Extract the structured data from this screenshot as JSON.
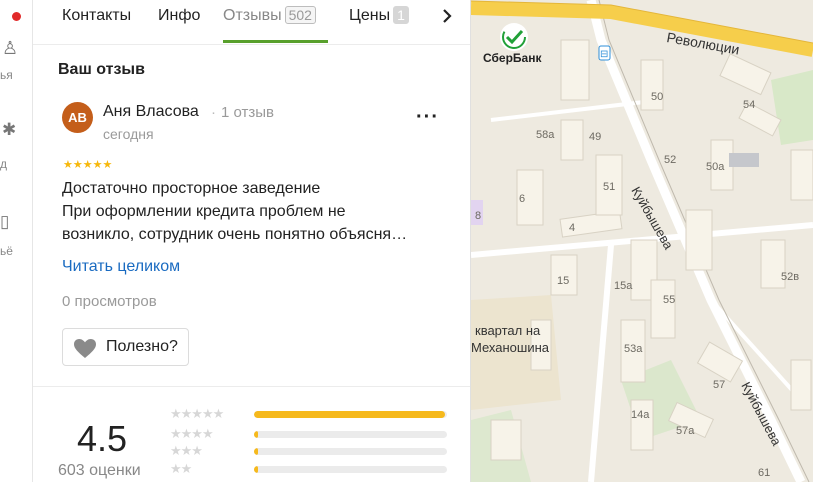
{
  "left_strip": {
    "fragments": [
      "ья",
      "д",
      "ьё"
    ]
  },
  "tabs": [
    {
      "label": "Контакты"
    },
    {
      "label": "Инфо"
    },
    {
      "label": "Отзывы",
      "count": "502"
    },
    {
      "label": "Цены",
      "count": "1"
    }
  ],
  "section": {
    "title": "Ваш отзыв"
  },
  "review": {
    "avatar_initials": "АВ",
    "author": "Аня Власова",
    "author_reviews": "1 отзыв",
    "date": "сегодня",
    "stars": 5,
    "stars_text": "★★★★★",
    "text_lines": [
      "Достаточно просторное заведение",
      "При оформлении кредита проблем не",
      "возникло, сотрудник очень понятно объясня…"
    ],
    "read_more": "Читать целиком",
    "views": "0 просмотров",
    "helpful_label": "Полезно?"
  },
  "rating": {
    "value": "4.5",
    "count_label": "603 оценки",
    "distribution": [
      {
        "stars": "★★★★★",
        "fraction": 0.99
      },
      {
        "stars": "★★★★",
        "fraction": 0.02
      },
      {
        "stars": "★★★",
        "fraction": 0.02
      },
      {
        "stars": "★★",
        "fraction": 0.02
      }
    ]
  },
  "map": {
    "street_labels": [
      "Революции",
      "Куйбышева",
      "Куйбышева"
    ],
    "poi": "СберБанк",
    "area_label_lines": [
      "квартал на",
      "Механошина"
    ],
    "building_numbers": [
      "50",
      "54",
      "58а",
      "49",
      "52",
      "50а",
      "51",
      "6",
      "4",
      "8",
      "15",
      "15а",
      "55",
      "53а",
      "52в",
      "57",
      "14а",
      "57а",
      "61"
    ]
  },
  "colors": {
    "accent_green": "#58a02c",
    "link_blue": "#1a6bc1",
    "star_yellow": "#f7b80c",
    "avatar_bg": "#c45e1a",
    "road_yellow": "#f6ce4b",
    "notification_red": "#e12a2a"
  }
}
